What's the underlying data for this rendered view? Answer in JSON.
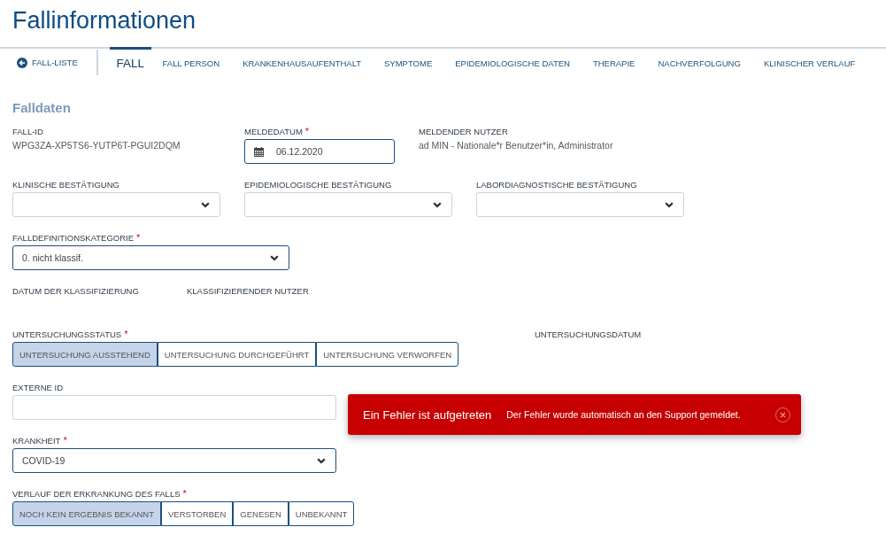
{
  "page": {
    "title": "Fallinformationen"
  },
  "nav": {
    "back_link": "FALL-LISTE",
    "tabs": [
      {
        "label": "FALL",
        "selected": true
      },
      {
        "label": "FALL PERSON",
        "selected": false
      },
      {
        "label": "KRANKENHAUSAUFENTHALT",
        "selected": false
      },
      {
        "label": "SYMPTOME",
        "selected": false
      },
      {
        "label": "EPIDEMIOLOGISCHE DATEN",
        "selected": false
      },
      {
        "label": "THERAPIE",
        "selected": false
      },
      {
        "label": "NACHVERFOLGUNG",
        "selected": false
      },
      {
        "label": "KLINISCHER VERLAUF",
        "selected": false
      }
    ]
  },
  "section": {
    "title": "Falldaten",
    "rows": [
      {
        "fields": [
          {
            "kind": "text",
            "label": "FALL-ID",
            "value": "WPG3ZA-XP5TS6-YUTP6T-PGUI2DQM"
          },
          {
            "kind": "date",
            "label": "MELDEDATUM",
            "required_mark": "*",
            "value": "06.12.2020"
          },
          {
            "kind": "text",
            "label": "MELDENDER NUTZER",
            "value": "ad MIN - Nationale*r Benutzer*in, Administrator"
          }
        ]
      },
      {
        "fields": [
          {
            "kind": "select",
            "label": "KLINISCHE BESTÄTIGUNG"
          },
          {
            "kind": "select",
            "label": "EPIDEMIOLOGISCHE BESTÄTIGUNG"
          },
          {
            "kind": "select",
            "label": "LABORDIAGNOSTISCHE BESTÄTIGUNG"
          }
        ]
      },
      {
        "fields": [
          {
            "kind": "select",
            "label": "FALLDEFINITIONSKATEGORIE",
            "required_mark": "*",
            "value": "0. nicht klassif."
          }
        ]
      },
      {
        "fields": [
          {
            "kind": "text",
            "label": "DATUM DER KLASSIFIZIERUNG"
          },
          {
            "kind": "text",
            "label": "KLASSIFIZIERENDER NUTZER"
          }
        ]
      },
      {
        "fields": [
          {
            "kind": "toggle_group",
            "label": "UNTERSUCHUNGSSTATUS",
            "required_mark": "*",
            "options": [
              {
                "label": "UNTERSUCHUNG AUSSTEHEND",
                "selected": true
              },
              {
                "label": "UNTERSUCHUNG DURCHGEFÜHRT",
                "selected": false
              },
              {
                "label": "UNTERSUCHUNG VERWORFEN",
                "selected": false
              }
            ]
          },
          {
            "kind": "text",
            "label": "UNTERSUCHUNGSDATUM"
          }
        ]
      },
      {
        "fields": [
          {
            "kind": "input",
            "label": "EXTERNE ID"
          }
        ]
      },
      {
        "fields": [
          {
            "kind": "select",
            "label": "KRANKHEIT",
            "required_mark": "*",
            "value": "COVID-19"
          }
        ]
      },
      {
        "fields": [
          {
            "kind": "toggle_group",
            "label": "VERLAUF DER ERKRANKUNG DES FALLS",
            "required_mark": "*",
            "options": [
              {
                "label": "NOCH KEIN ERGEBNIS BEKANNT",
                "selected": true
              },
              {
                "label": "VERSTORBEN",
                "selected": false
              },
              {
                "label": "GENESEN",
                "selected": false
              },
              {
                "label": "UNBEKANNT",
                "selected": false
              }
            ]
          }
        ]
      }
    ]
  },
  "toast": {
    "title": "Ein Fehler ist aufgetreten",
    "message": "Der Fehler wurde automatisch an den Support gemeldet."
  }
}
